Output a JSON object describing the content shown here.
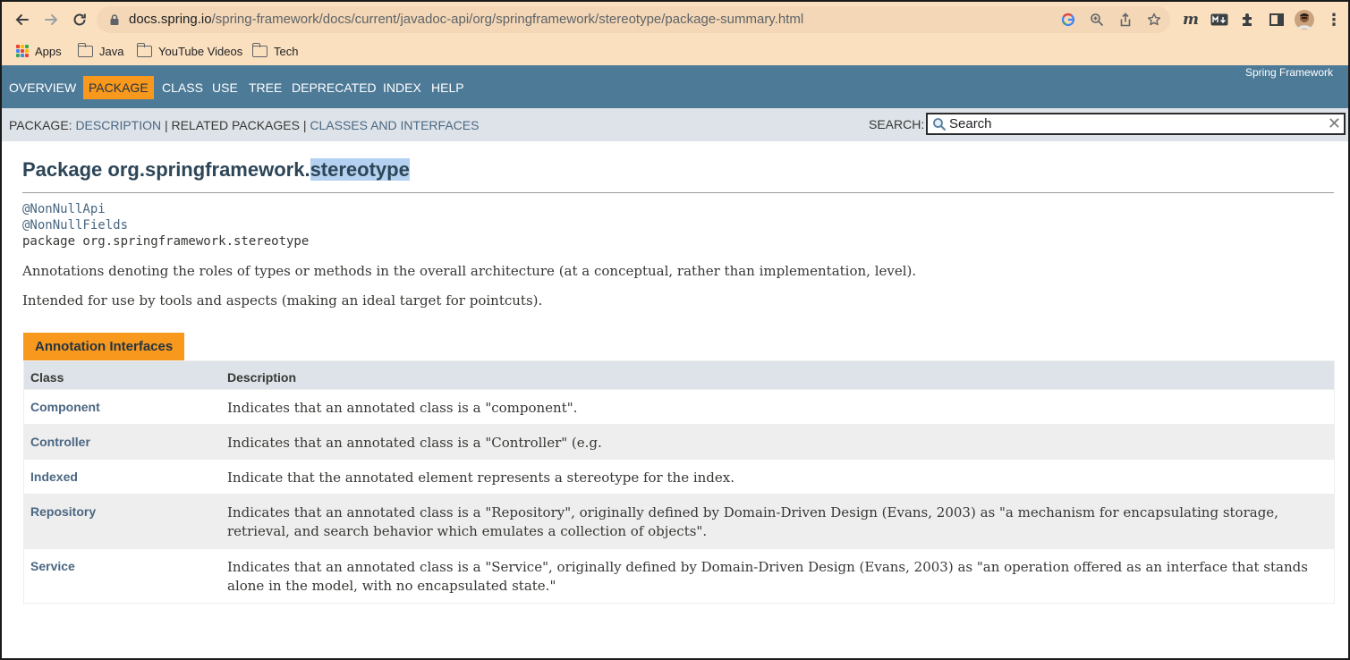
{
  "browser": {
    "url_host": "docs.spring.io",
    "url_path": "/spring-framework/docs/current/javadoc-api/org/springframework/stereotype/package-summary.html",
    "bookmarks": [
      {
        "label": "Apps"
      },
      {
        "label": "Java"
      },
      {
        "label": "YouTube Videos"
      },
      {
        "label": "Tech"
      }
    ],
    "colors": {
      "toolbar": "#fbe0bf",
      "omnibox": "#f3d7b6"
    }
  },
  "header": {
    "nav": [
      "OVERVIEW",
      "PACKAGE",
      "CLASS",
      "USE",
      "TREE",
      "DEPRECATED",
      "INDEX",
      "HELP"
    ],
    "active": "PACKAGE",
    "brand": "Spring Framework",
    "colors": {
      "nav_bg": "#4d7a97",
      "active_bg": "#f8981d",
      "subnav_bg": "#dee3e9"
    }
  },
  "subnav": {
    "prefix": "PACKAGE:",
    "description": "DESCRIPTION",
    "sep1": " | ",
    "related": "RELATED PACKAGES",
    "sep2": " | ",
    "classes": "CLASSES AND INTERFACES",
    "search_label": "SEARCH:",
    "search_placeholder": "Search"
  },
  "content": {
    "title_prefix": "Package org.springframework.",
    "title_highlight": "stereotype",
    "annotations": [
      "@NonNullApi",
      "@NonNullFields"
    ],
    "package_decl": "package org.springframework.stereotype",
    "paragraphs": [
      "Annotations denoting the roles of types or methods in the overall architecture (at a conceptual, rather than implementation, level).",
      "Intended for use by tools and aspects (making an ideal target for pointcuts)."
    ]
  },
  "summary_table": {
    "caption": "Annotation Interfaces",
    "columns": [
      "Class",
      "Description"
    ],
    "rows": [
      {
        "class": "Component",
        "description": "Indicates that an annotated class is a \"component\"."
      },
      {
        "class": "Controller",
        "description": "Indicates that an annotated class is a \"Controller\" (e.g."
      },
      {
        "class": "Indexed",
        "description": "Indicate that the annotated element represents a stereotype for the index."
      },
      {
        "class": "Repository",
        "description": "Indicates that an annotated class is a \"Repository\", originally defined by Domain-Driven Design (Evans, 2003) as \"a mechanism for encapsulating storage, retrieval, and search behavior which emulates a collection of objects\"."
      },
      {
        "class": "Service",
        "description": "Indicates that an annotated class is a \"Service\", originally defined by Domain-Driven Design (Evans, 2003) as \"an operation offered as an interface that stands alone in the model, with no encapsulated state.\""
      }
    ]
  }
}
